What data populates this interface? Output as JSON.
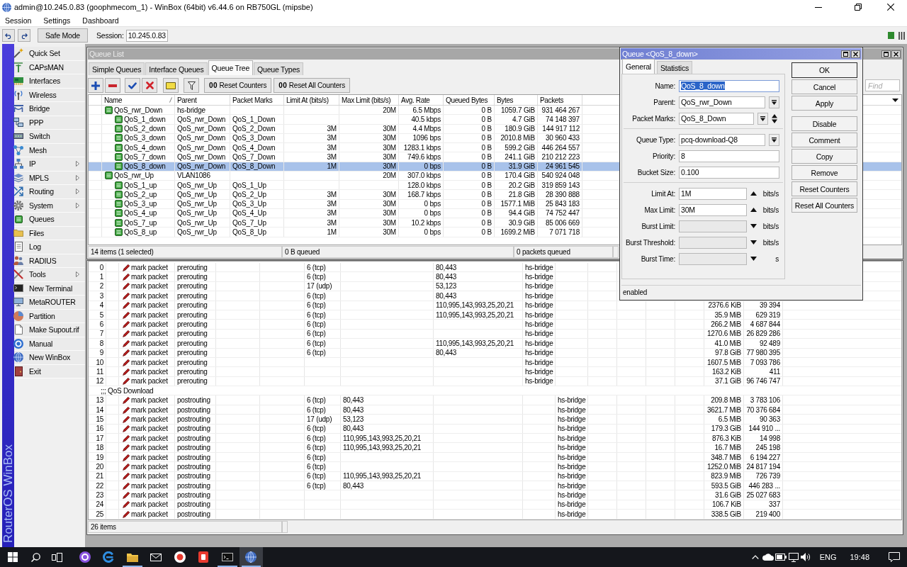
{
  "window": {
    "title": "admin@10.245.0.83 (goophmecom_1) - WinBox (64bit) v6.44.6 on RB750GL (mipsbe)"
  },
  "menu": [
    "Session",
    "Settings",
    "Dashboard"
  ],
  "toolbar": {
    "safe_mode": "Safe Mode",
    "session_label": "Session:",
    "session": "10.245.0.83"
  },
  "sidebar": {
    "brand": "RouterOS WinBox",
    "items": [
      {
        "label": "Quick Set",
        "has_submenu": false
      },
      {
        "label": "CAPsMAN",
        "has_submenu": false
      },
      {
        "label": "Interfaces",
        "has_submenu": false
      },
      {
        "label": "Wireless",
        "has_submenu": false
      },
      {
        "label": "Bridge",
        "has_submenu": false
      },
      {
        "label": "PPP",
        "has_submenu": false
      },
      {
        "label": "Switch",
        "has_submenu": false
      },
      {
        "label": "Mesh",
        "has_submenu": false
      },
      {
        "label": "IP",
        "has_submenu": true
      },
      {
        "label": "MPLS",
        "has_submenu": true
      },
      {
        "label": "Routing",
        "has_submenu": true
      },
      {
        "label": "System",
        "has_submenu": true
      },
      {
        "label": "Queues",
        "has_submenu": false
      },
      {
        "label": "Files",
        "has_submenu": false
      },
      {
        "label": "Log",
        "has_submenu": false
      },
      {
        "label": "RADIUS",
        "has_submenu": false
      },
      {
        "label": "Tools",
        "has_submenu": true
      },
      {
        "label": "New Terminal",
        "has_submenu": false
      },
      {
        "label": "MetaROUTER",
        "has_submenu": false
      },
      {
        "label": "Partition",
        "has_submenu": false
      },
      {
        "label": "Make Supout.rif",
        "has_submenu": false
      },
      {
        "label": "Manual",
        "has_submenu": false
      },
      {
        "label": "New WinBox",
        "has_submenu": false
      },
      {
        "label": "Exit",
        "has_submenu": false
      }
    ]
  },
  "queue_list": {
    "title": "Queue List",
    "tabs": [
      {
        "label": "Simple Queues",
        "selected": false
      },
      {
        "label": "Interface Queues",
        "selected": false
      },
      {
        "label": "Queue Tree",
        "selected": true
      },
      {
        "label": "Queue Types",
        "selected": false
      }
    ],
    "buttons": [
      {
        "counter": "00",
        "label": "Reset Counters"
      },
      {
        "counter": "00",
        "label": "Reset All Counters"
      }
    ],
    "find": {
      "placeholder": "Find"
    },
    "columns": [
      {
        "label": "Name",
        "sorted": true
      },
      {
        "label": "Parent",
        "sorted": false
      },
      {
        "label": "Packet Marks",
        "sorted": false
      },
      {
        "label": "Limit At (bits/s)",
        "sorted": false
      },
      {
        "label": "Max Limit (bits/s)",
        "sorted": false
      },
      {
        "label": "Avg. Rate",
        "sorted": false
      },
      {
        "label": "Queued Bytes",
        "sorted": false
      },
      {
        "label": "Bytes",
        "sorted": false
      },
      {
        "label": "Packets",
        "sorted": false
      }
    ],
    "rows": [
      {
        "name": "QoS_rwr_Down",
        "parent": "hs-bridge",
        "max_limit": "20M",
        "avg_rate": "6.5 Mbps",
        "queued_bytes": "0 B",
        "bytes": "1059.7 GiB",
        "packets": "931 464 267",
        "selected": false,
        "children": [
          {
            "name": "QoS_1_down",
            "parent": "QoS_rwr_Down",
            "packet_marks": "QoS_1_Down",
            "avg_rate": "40.5 kbps",
            "queued_bytes": "0 B",
            "bytes": "4.7 GiB",
            "packets": "74 148 397",
            "selected": false
          },
          {
            "name": "QoS_2_down",
            "parent": "QoS_rwr_Down",
            "packet_marks": "QoS_2_Down",
            "limit_at": "3M",
            "max_limit": "30M",
            "avg_rate": "4.4 Mbps",
            "queued_bytes": "0 B",
            "bytes": "180.9 GiB",
            "packets": "144 917 112",
            "selected": false
          },
          {
            "name": "QoS_3_down",
            "parent": "QoS_rwr_Down",
            "packet_marks": "QoS_3_Down",
            "limit_at": "3M",
            "max_limit": "30M",
            "avg_rate": "1096 bps",
            "queued_bytes": "0 B",
            "bytes": "2010.8 MiB",
            "packets": "30 960 433",
            "selected": false
          },
          {
            "name": "QoS_4_down",
            "parent": "QoS_rwr_Down",
            "packet_marks": "QoS_4_Down",
            "limit_at": "3M",
            "max_limit": "30M",
            "avg_rate": "1283.1 kbps",
            "queued_bytes": "0 B",
            "bytes": "599.2 GiB",
            "packets": "446 264 557",
            "selected": false
          },
          {
            "name": "QoS_7_down",
            "parent": "QoS_rwr_Down",
            "packet_marks": "QoS_7_Down",
            "limit_at": "3M",
            "max_limit": "30M",
            "avg_rate": "749.6 kbps",
            "queued_bytes": "0 B",
            "bytes": "241.1 GiB",
            "packets": "210 212 223",
            "selected": false
          },
          {
            "name": "QoS_8_down",
            "parent": "QoS_rwr_Down",
            "packet_marks": "QoS_8_Down",
            "limit_at": "1M",
            "max_limit": "30M",
            "avg_rate": "0 bps",
            "queued_bytes": "0 B",
            "bytes": "31.9 GiB",
            "packets": "24 961 545",
            "selected": true
          }
        ]
      },
      {
        "name": "QoS_rwr_Up",
        "parent": "VLAN1086",
        "max_limit": "20M",
        "avg_rate": "307.0 kbps",
        "queued_bytes": "0 B",
        "bytes": "170.4 GiB",
        "packets": "540 924 048",
        "selected": false,
        "children": [
          {
            "name": "QoS_1_up",
            "parent": "QoS_rwr_Up",
            "packet_marks": "QoS_1_Up",
            "avg_rate": "128.0 kbps",
            "queued_bytes": "0 B",
            "bytes": "20.2 GiB",
            "packets": "319 859 143",
            "selected": false
          },
          {
            "name": "QoS_2_up",
            "parent": "QoS_rwr_Up",
            "packet_marks": "QoS_2_Up",
            "limit_at": "3M",
            "max_limit": "30M",
            "avg_rate": "168.7 kbps",
            "queued_bytes": "0 B",
            "bytes": "21.8 GiB",
            "packets": "28 390 888",
            "selected": false
          },
          {
            "name": "QoS_3_up",
            "parent": "QoS_rwr_Up",
            "packet_marks": "QoS_3_Up",
            "limit_at": "3M",
            "max_limit": "30M",
            "avg_rate": "0 bps",
            "queued_bytes": "0 B",
            "bytes": "1577.1 MiB",
            "packets": "25 843 183",
            "selected": false
          },
          {
            "name": "QoS_4_up",
            "parent": "QoS_rwr_Up",
            "packet_marks": "QoS_4_Up",
            "limit_at": "3M",
            "max_limit": "30M",
            "avg_rate": "0 bps",
            "queued_bytes": "0 B",
            "bytes": "94.4 GiB",
            "packets": "74 752 447",
            "selected": false
          },
          {
            "name": "QoS_7_up",
            "parent": "QoS_rwr_Up",
            "packet_marks": "QoS_7_Up",
            "limit_at": "3M",
            "max_limit": "30M",
            "avg_rate": "10.2 kbps",
            "queued_bytes": "0 B",
            "bytes": "30.9 GiB",
            "packets": "85 006 669",
            "selected": false
          },
          {
            "name": "QoS_8_up",
            "parent": "QoS_rwr_Up",
            "packet_marks": "QoS_8_Up",
            "limit_at": "1M",
            "max_limit": "30M",
            "avg_rate": "0 bps",
            "queued_bytes": "0 B",
            "bytes": "1699.2 MiB",
            "packets": "7 071 718",
            "selected": false
          }
        ]
      }
    ],
    "status_bar": [
      "14 items (1 selected)",
      "0 B queued",
      "0 packets queued"
    ]
  },
  "mangle_list": {
    "rows": [
      {
        "kind": "rule",
        "column_1": "0",
        "column_3": "mark packet",
        "column_4": "prerouting",
        "column_7": "6 (tcp)",
        "column_9": "80,443",
        "column_10": "hs-bridge"
      },
      {
        "kind": "rule",
        "column_1": "1",
        "column_3": "mark packet",
        "column_4": "prerouting",
        "column_7": "6 (tcp)",
        "column_9": "80,443",
        "column_10": "hs-bridge"
      },
      {
        "kind": "rule",
        "column_1": "2",
        "column_3": "mark packet",
        "column_4": "prerouting",
        "column_7": "17 (udp)",
        "column_9": "53,123",
        "column_10": "hs-bridge"
      },
      {
        "kind": "rule",
        "column_1": "3",
        "column_3": "mark packet",
        "column_4": "prerouting",
        "column_7": "6 (tcp)",
        "column_9": "80,443",
        "column_10": "hs-bridge"
      },
      {
        "kind": "rule",
        "column_1": "4",
        "column_3": "mark packet",
        "column_4": "prerouting",
        "column_7": "6 (tcp)",
        "column_9": "110,995,143,993,25,20,21",
        "column_10": "hs-bridge",
        "column_16": "2376.6 KiB",
        "column_17": "39 394"
      },
      {
        "kind": "rule",
        "column_1": "5",
        "column_3": "mark packet",
        "column_4": "prerouting",
        "column_7": "6 (tcp)",
        "column_9": "110,995,143,993,25,20,21",
        "column_10": "hs-bridge",
        "column_16": "35.9 MiB",
        "column_17": "629 319"
      },
      {
        "kind": "rule",
        "column_1": "6",
        "column_3": "mark packet",
        "column_4": "prerouting",
        "column_7": "6 (tcp)",
        "column_10": "hs-bridge",
        "column_16": "266.2 MiB",
        "column_17": "4 687 844"
      },
      {
        "kind": "rule",
        "column_1": "7",
        "column_3": "mark packet",
        "column_4": "prerouting",
        "column_7": "6 (tcp)",
        "column_10": "hs-bridge",
        "column_16": "1270.6 MiB",
        "column_17": "26 829 286"
      },
      {
        "kind": "rule",
        "column_1": "8",
        "column_3": "mark packet",
        "column_4": "prerouting",
        "column_7": "6 (tcp)",
        "column_9": "110,995,143,993,25,20,21",
        "column_10": "hs-bridge",
        "column_16": "41.0 MiB",
        "column_17": "92 489"
      },
      {
        "kind": "rule",
        "column_1": "9",
        "column_3": "mark packet",
        "column_4": "prerouting",
        "column_7": "6 (tcp)",
        "column_9": "80,443",
        "column_10": "hs-bridge",
        "column_16": "97.8 GiB",
        "column_17": "77 980 395"
      },
      {
        "kind": "rule",
        "column_1": "10",
        "column_3": "mark packet",
        "column_4": "prerouting",
        "column_10": "hs-bridge",
        "column_16": "1607.5 MiB",
        "column_17": "7 093 786"
      },
      {
        "kind": "rule",
        "column_1": "11",
        "column_3": "mark packet",
        "column_4": "prerouting",
        "column_10": "hs-bridge",
        "column_16": "163.2 KiB",
        "column_17": "411"
      },
      {
        "kind": "rule",
        "column_1": "12",
        "column_3": "mark packet",
        "column_4": "prerouting",
        "column_10": "hs-bridge",
        "column_16": "37.1 GiB",
        "column_17": "96 746 747"
      },
      {
        "kind": "comment",
        "text": ";;; QoS Download"
      },
      {
        "kind": "rule",
        "column_1": "13",
        "column_3": "mark packet",
        "column_4": "postrouting",
        "column_7": "6 (tcp)",
        "column_8": "80,443",
        "column_11": "hs-bridge",
        "column_16": "209.8 MiB",
        "column_17": "3 783 106"
      },
      {
        "kind": "rule",
        "column_1": "14",
        "column_3": "mark packet",
        "column_4": "postrouting",
        "column_7": "6 (tcp)",
        "column_8": "80,443",
        "column_11": "hs-bridge",
        "column_16": "3621.7 MiB",
        "column_17": "70 376 684"
      },
      {
        "kind": "rule",
        "column_1": "15",
        "column_3": "mark packet",
        "column_4": "postrouting",
        "column_7": "17 (udp)",
        "column_8": "53,123",
        "column_11": "hs-bridge",
        "column_16": "6.5 MiB",
        "column_17": "90 363"
      },
      {
        "kind": "rule",
        "column_1": "16",
        "column_3": "mark packet",
        "column_4": "postrouting",
        "column_7": "6 (tcp)",
        "column_8": "80,443",
        "column_11": "hs-bridge",
        "column_16": "179.3 GiB",
        "column_17": "144 910 ..."
      },
      {
        "kind": "rule",
        "column_1": "17",
        "column_3": "mark packet",
        "column_4": "postrouting",
        "column_7": "6 (tcp)",
        "column_8": "110,995,143,993,25,20,21",
        "column_11": "hs-bridge",
        "column_16": "876.3 KiB",
        "column_17": "14 998"
      },
      {
        "kind": "rule",
        "column_1": "18",
        "column_3": "mark packet",
        "column_4": "postrouting",
        "column_7": "6 (tcp)",
        "column_8": "110,995,143,993,25,20,21",
        "column_11": "hs-bridge",
        "column_16": "16.7 MiB",
        "column_17": "245 198"
      },
      {
        "kind": "rule",
        "column_1": "19",
        "column_3": "mark packet",
        "column_4": "postrouting",
        "column_7": "6 (tcp)",
        "column_11": "hs-bridge",
        "column_16": "348.7 MiB",
        "column_17": "6 194 227"
      },
      {
        "kind": "rule",
        "column_1": "20",
        "column_3": "mark packet",
        "column_4": "postrouting",
        "column_7": "6 (tcp)",
        "column_11": "hs-bridge",
        "column_16": "1252.0 MiB",
        "column_17": "24 817 194"
      },
      {
        "kind": "rule",
        "column_1": "21",
        "column_3": "mark packet",
        "column_4": "postrouting",
        "column_7": "6 (tcp)",
        "column_8": "110,995,143,993,25,20,21",
        "column_11": "hs-bridge",
        "column_16": "823.9 MiB",
        "column_17": "726 739"
      },
      {
        "kind": "rule",
        "column_1": "22",
        "column_3": "mark packet",
        "column_4": "postrouting",
        "column_7": "6 (tcp)",
        "column_8": "80,443",
        "column_11": "hs-bridge",
        "column_16": "593.5 GiB",
        "column_17": "446 283 ..."
      },
      {
        "kind": "rule",
        "column_1": "23",
        "column_3": "mark packet",
        "column_4": "postrouting",
        "column_11": "hs-bridge",
        "column_16": "31.6 GiB",
        "column_17": "25 027 683"
      },
      {
        "kind": "rule",
        "column_1": "24",
        "column_3": "mark packet",
        "column_4": "postrouting",
        "column_11": "hs-bridge",
        "column_16": "106.7 KiB",
        "column_17": "337"
      },
      {
        "kind": "rule",
        "column_1": "25",
        "column_3": "mark packet",
        "column_4": "postrouting",
        "column_11": "hs-bridge",
        "column_16": "338.5 GiB",
        "column_17": "219 400"
      }
    ],
    "status_bar": "26 items"
  },
  "queue_dialog": {
    "title": "Queue <QoS_8_down>",
    "tabs": [
      {
        "label": "General",
        "selected": true
      },
      {
        "label": "Statistics",
        "selected": false
      }
    ],
    "field_groups": [
      [
        {
          "kind": "text",
          "label": "Name:",
          "value": "QoS_8_down",
          "highlighted": true,
          "disabled": false
        },
        {
          "kind": "dropdown",
          "label": "Parent:",
          "value": "QoS_rwr_Down",
          "highlighted": false,
          "disabled": false
        },
        {
          "kind": "multi",
          "label": "Packet Marks:",
          "value": "QoS_8_Down",
          "highlighted": false,
          "disabled": false
        }
      ],
      [
        {
          "kind": "dropdown",
          "label": "Queue Type:",
          "value": "pcq-download-Q8",
          "highlighted": false,
          "disabled": false
        },
        {
          "kind": "text",
          "label": "Priority:",
          "value": "8",
          "highlighted": false,
          "disabled": false
        },
        {
          "kind": "text",
          "label": "Bucket Size:",
          "value": "0.100",
          "highlighted": false,
          "disabled": false
        }
      ],
      [
        {
          "kind": "toggle",
          "label": "Limit At:",
          "value": "1M",
          "unit": "bits/s",
          "highlighted": false,
          "disabled": false
        },
        {
          "kind": "toggle",
          "label": "Max Limit:",
          "value": "30M",
          "unit": "bits/s",
          "highlighted": false,
          "disabled": false
        },
        {
          "kind": "toggle",
          "label": "Burst Limit:",
          "unit": "bits/s",
          "highlighted": false,
          "disabled": true
        },
        {
          "kind": "toggle",
          "label": "Burst Threshold:",
          "unit": "bits/s",
          "highlighted": false,
          "disabled": true
        },
        {
          "kind": "toggle",
          "label": "Burst Time:",
          "unit": "s",
          "highlighted": false,
          "disabled": true
        }
      ]
    ],
    "button_groups": [
      [
        {
          "label": "OK",
          "default": true
        },
        {
          "label": "Cancel",
          "default": false
        },
        {
          "label": "Apply",
          "default": false
        }
      ],
      [
        {
          "label": "Disable",
          "default": false
        },
        {
          "label": "Comment",
          "default": false
        },
        {
          "label": "Copy",
          "default": false
        },
        {
          "label": "Remove",
          "default": false
        },
        {
          "label": "Reset Counters",
          "default": false
        },
        {
          "label": "Reset All Counters",
          "default": false
        }
      ]
    ],
    "status_bar": "enabled"
  },
  "taskbar": {
    "apps": [
      {
        "running": false,
        "active": false
      },
      {
        "running": false,
        "active": false
      },
      {
        "running": true,
        "active": false
      },
      {
        "running": false,
        "active": false
      },
      {
        "running": false,
        "active": false
      },
      {
        "running": false,
        "active": false
      },
      {
        "running": true,
        "active": false
      },
      {
        "running": true,
        "active": true
      }
    ],
    "language": "ENG",
    "time": "19:48"
  }
}
